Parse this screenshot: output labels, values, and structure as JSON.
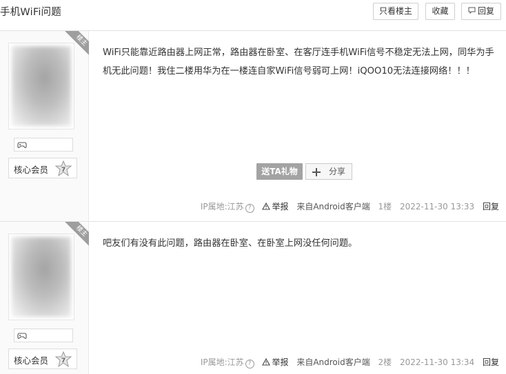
{
  "header": {
    "title": "手机WiFi问题",
    "buttons": {
      "only_op": "只看楼主",
      "favorite": "收藏",
      "reply": "回复"
    }
  },
  "posts": [
    {
      "op_tag": "楼主",
      "member_label": "核心会员",
      "member_level": "7",
      "content": "WiFi只能靠近路由器上网正常，路由器在卧室、在客厅连手机WiFi信号不稳定无法上网，同华为手机无此问题！我住二楼用华为在一楼连自家WiFi信号弱可上网！iQOO10无法连接网络！！！",
      "gift": "送TA礼物",
      "share": "分享",
      "ip": "IP属地:江苏",
      "report": "举报",
      "source": "来自Android客户端",
      "floor": "1楼",
      "time": "2022-11-30 13:33",
      "reply": "回复"
    },
    {
      "op_tag": "楼主",
      "member_label": "核心会员",
      "member_level": "7",
      "content": "吧友们有没有此问题，路由器在卧室、在卧室上网没任何问题。",
      "ip": "IP属地:江苏",
      "report": "举报",
      "source": "来自Android客户端",
      "floor": "2楼",
      "time": "2022-11-30 13:34",
      "reply": "回复"
    }
  ]
}
